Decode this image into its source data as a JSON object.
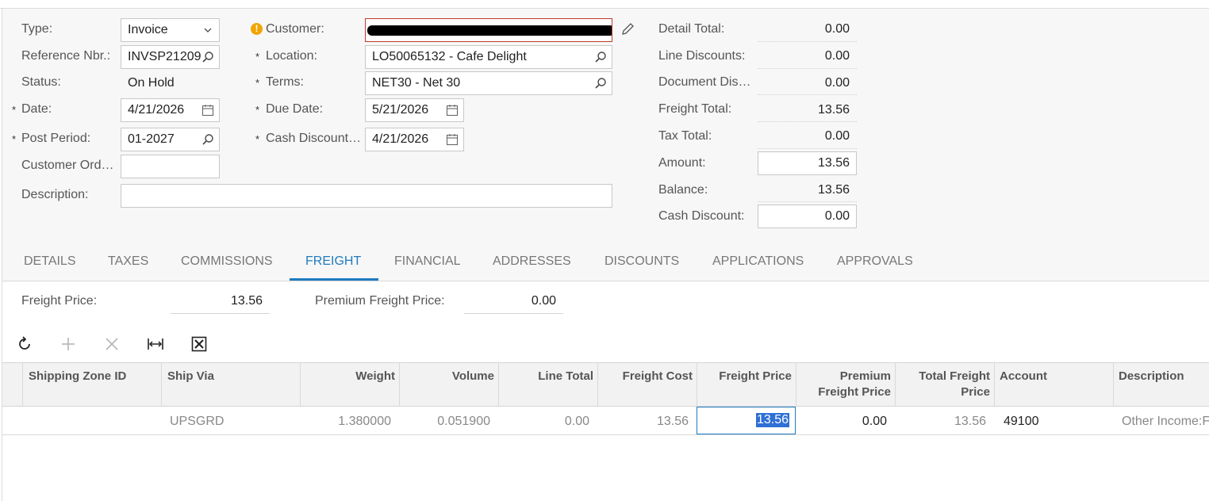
{
  "form": {
    "type": {
      "label": "Type:",
      "value": "Invoice"
    },
    "reference_nbr": {
      "label": "Reference Nbr.:",
      "value": "INVSP21209"
    },
    "status": {
      "label": "Status:",
      "value": "On Hold"
    },
    "date": {
      "label": "Date:",
      "value": "4/21/2026",
      "required": "*"
    },
    "post_period": {
      "label": "Post Period:",
      "value": "01-2027",
      "required": "*"
    },
    "customer_order": {
      "label": "Customer Ord…",
      "value": ""
    },
    "description": {
      "label": "Description:",
      "value": ""
    },
    "customer": {
      "label": "Customer:",
      "value": "",
      "warning_glyph": "!"
    },
    "location": {
      "label": "Location:",
      "value": "LO50065132 - Cafe Delight",
      "required": "*"
    },
    "terms": {
      "label": "Terms:",
      "value": "NET30 - Net 30",
      "required": "*"
    },
    "due_date": {
      "label": "Due Date:",
      "value": "5/21/2026",
      "required": "*"
    },
    "cash_discount_date": {
      "label": "Cash Discount…",
      "value": "4/21/2026",
      "required": "*"
    }
  },
  "summary": {
    "detail_total": {
      "label": "Detail Total:",
      "value": "0.00"
    },
    "line_discounts": {
      "label": "Line Discounts:",
      "value": "0.00"
    },
    "document_discounts": {
      "label": "Document Dis…",
      "value": "0.00"
    },
    "freight_total": {
      "label": "Freight Total:",
      "value": "13.56"
    },
    "tax_total": {
      "label": "Tax Total:",
      "value": "0.00"
    },
    "amount": {
      "label": "Amount:",
      "value": "13.56"
    },
    "balance": {
      "label": "Balance:",
      "value": "13.56"
    },
    "cash_discount": {
      "label": "Cash Discount:",
      "value": "0.00"
    }
  },
  "tabs": [
    {
      "label": "DETAILS"
    },
    {
      "label": "TAXES"
    },
    {
      "label": "COMMISSIONS"
    },
    {
      "label": "FREIGHT",
      "active": true
    },
    {
      "label": "FINANCIAL"
    },
    {
      "label": "ADDRESSES"
    },
    {
      "label": "DISCOUNTS"
    },
    {
      "label": "APPLICATIONS"
    },
    {
      "label": "APPROVALS"
    }
  ],
  "freight": {
    "freight_price": {
      "label": "Freight Price:",
      "value": "13.56"
    },
    "premium_freight_price": {
      "label": "Premium Freight Price:",
      "value": "0.00"
    }
  },
  "toolbar": {
    "icons": [
      "refresh-icon",
      "add-icon",
      "delete-icon",
      "fit-columns-icon",
      "export-excel-icon"
    ]
  },
  "grid": {
    "columns": [
      {
        "line1": "Shipping Zone ID",
        "line2": ""
      },
      {
        "line1": "Ship Via",
        "line2": ""
      },
      {
        "line1": "Weight",
        "line2": ""
      },
      {
        "line1": "Volume",
        "line2": ""
      },
      {
        "line1": "Line Total",
        "line2": ""
      },
      {
        "line1": "Freight Cost",
        "line2": ""
      },
      {
        "line1": "Freight Price",
        "line2": ""
      },
      {
        "line1": "Premium",
        "line2": "Freight Price"
      },
      {
        "line1": "Total Freight",
        "line2": "Price"
      },
      {
        "line1": "Account",
        "line2": ""
      },
      {
        "line1": "Description",
        "line2": ""
      }
    ],
    "rows": [
      {
        "shipping_zone_id": "",
        "ship_via": "UPSGRD",
        "weight": "1.380000",
        "volume": "0.051900",
        "line_total": "0.00",
        "freight_cost": "13.56",
        "freight_price": "13.56",
        "premium_freight_price": "0.00",
        "total_freight_price": "13.56",
        "account": "49100",
        "description": "Other Income:F"
      }
    ]
  },
  "colors": {
    "accent": "#1f7bbf",
    "selection": "#2f6fd6",
    "warning": "#f0a500",
    "error_border": "#c0392b"
  }
}
